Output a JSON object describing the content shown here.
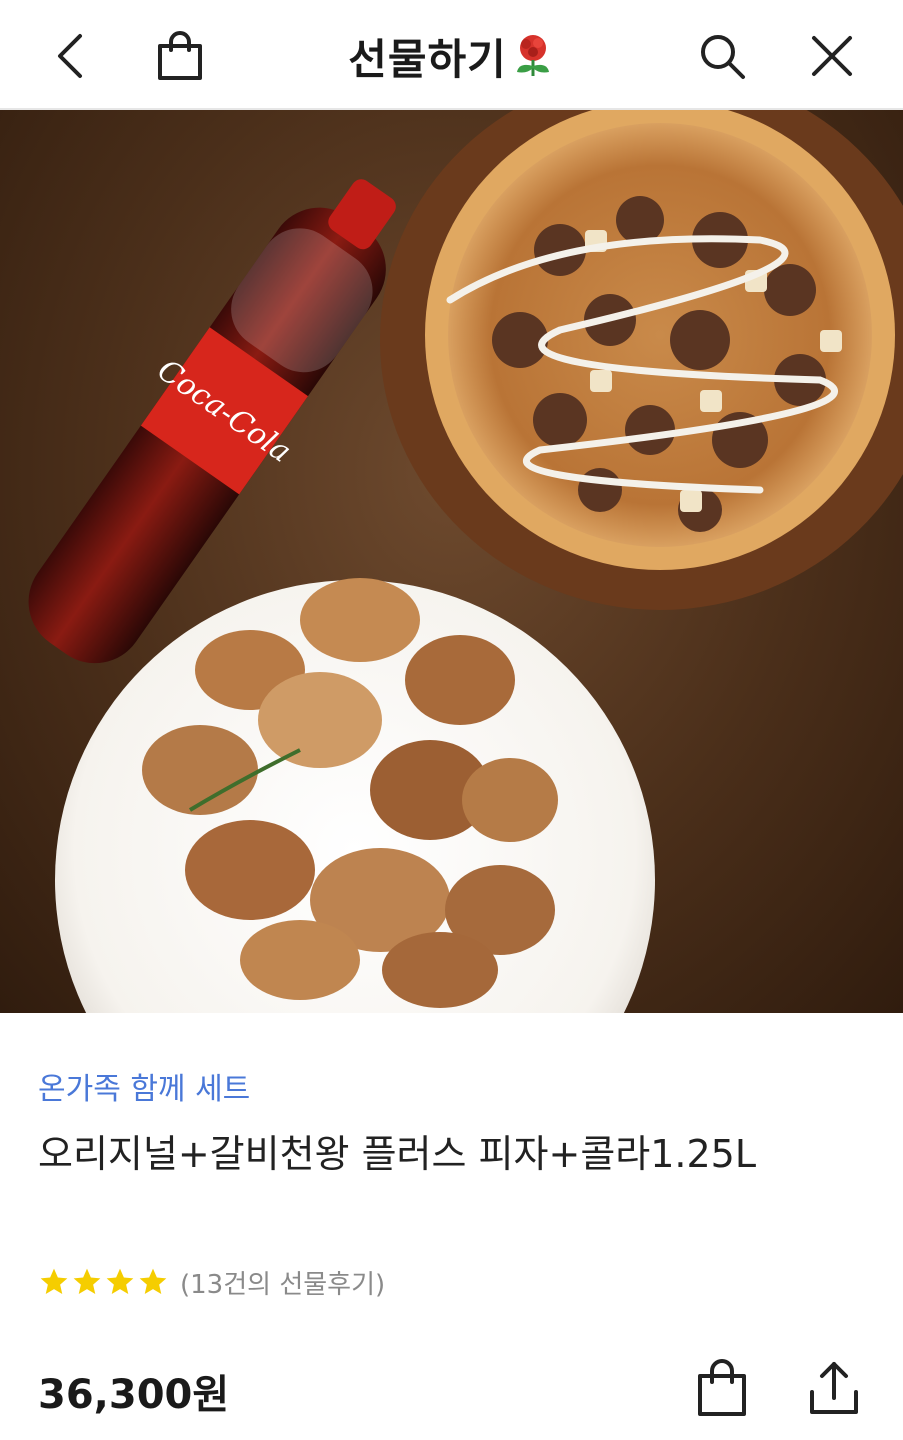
{
  "header": {
    "title": "선물하기",
    "icons": {
      "back": "chevron-left-icon",
      "bag": "shopping-bag-icon",
      "search": "search-icon",
      "close": "close-icon",
      "flower": "flower-icon"
    }
  },
  "product": {
    "image_label": "product-image",
    "category": "온가족 함께 세트",
    "name": "오리지널+갈비천왕 플러스 피자+콜라1.25L",
    "rating_stars": 4,
    "rating_max": 5,
    "review_count": "(13건의 선물후기)",
    "price": "36,300원"
  },
  "colors": {
    "category": "#4a78d8",
    "star": "#f5cd00",
    "text": "#222222"
  }
}
